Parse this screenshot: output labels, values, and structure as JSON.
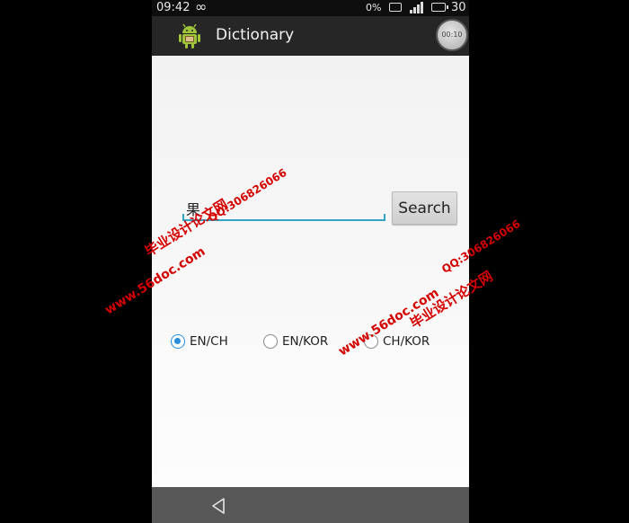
{
  "status_bar": {
    "time": "09:42",
    "infinity": "∞",
    "data_percent": "0%",
    "clock": "30"
  },
  "action_bar": {
    "title": "Dictionary",
    "timer": "00:10"
  },
  "search": {
    "value": "果",
    "button_label": "Search"
  },
  "languages": {
    "options": [
      {
        "label": "EN/CH",
        "checked": true
      },
      {
        "label": "EN/KOR",
        "checked": false
      },
      {
        "label": "CH/KOR",
        "checked": false
      }
    ]
  },
  "watermarks": {
    "site_name": "毕业设计论文网",
    "qq": "QQ:306826066",
    "url": "www.56doc.com"
  },
  "colors": {
    "accent": "#33a3c6",
    "radio": "#2a8bd9",
    "watermark": "#d40000"
  }
}
